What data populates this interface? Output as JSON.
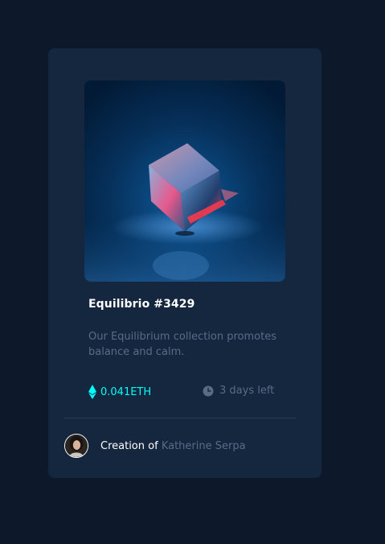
{
  "card": {
    "title": "Equilibrio #3429",
    "description": "Our Equilibrium collection promotes balance and calm.",
    "price": "0.041ETH",
    "time_left": "3 days left",
    "creator_prefix": "Creation of",
    "creator_name": "Katherine Serpa",
    "hero_image": "crystal-cube-image",
    "price_icon": "ethereum-icon",
    "time_icon": "clock-icon",
    "avatar_image": "creator-avatar"
  },
  "colors": {
    "page_background": "#0d192b",
    "card_background": "#15263f",
    "accent_cyan": "#00fff8",
    "muted_text": "#5a6b86",
    "title_text": "#ffffff",
    "divider": "#2a3a55"
  }
}
